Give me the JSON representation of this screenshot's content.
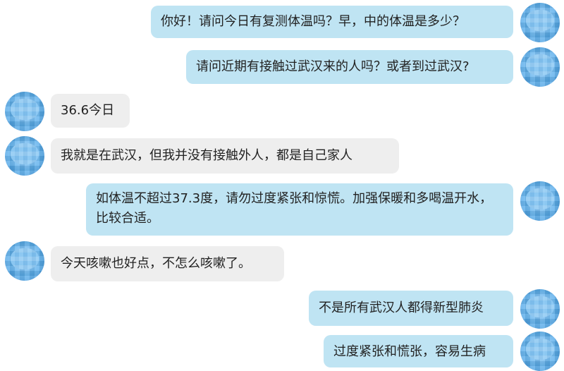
{
  "messages": [
    {
      "side": "right",
      "text": "你好！请问今日有复测体温吗？早，中的体温是多少？"
    },
    {
      "side": "right",
      "text": "请问近期有接触过武汉来的人吗？或者到过武汉?"
    },
    {
      "side": "left",
      "text": "36.6今日"
    },
    {
      "side": "left",
      "text": "我就是在武汉，但我并没有接触外人，都是自己家人"
    },
    {
      "side": "right",
      "text": "如体温不超过37.3度，请勿过度紧张和惊慌。加强保暖和多喝温开水，比较合适。"
    },
    {
      "side": "left",
      "text": "今天咳嗽也好点，不怎么咳嗽了。"
    },
    {
      "side": "right",
      "text": "不是所有武汉人都得新型肺炎"
    },
    {
      "side": "right",
      "text": "过度紧张和慌张，容易生病"
    }
  ],
  "avatar_icon": "pixelated-avatar",
  "colors": {
    "right_bubble": "#bfe4f3",
    "left_bubble": "#eeeeee",
    "avatar": "#5aaeec",
    "text": "#222222"
  }
}
